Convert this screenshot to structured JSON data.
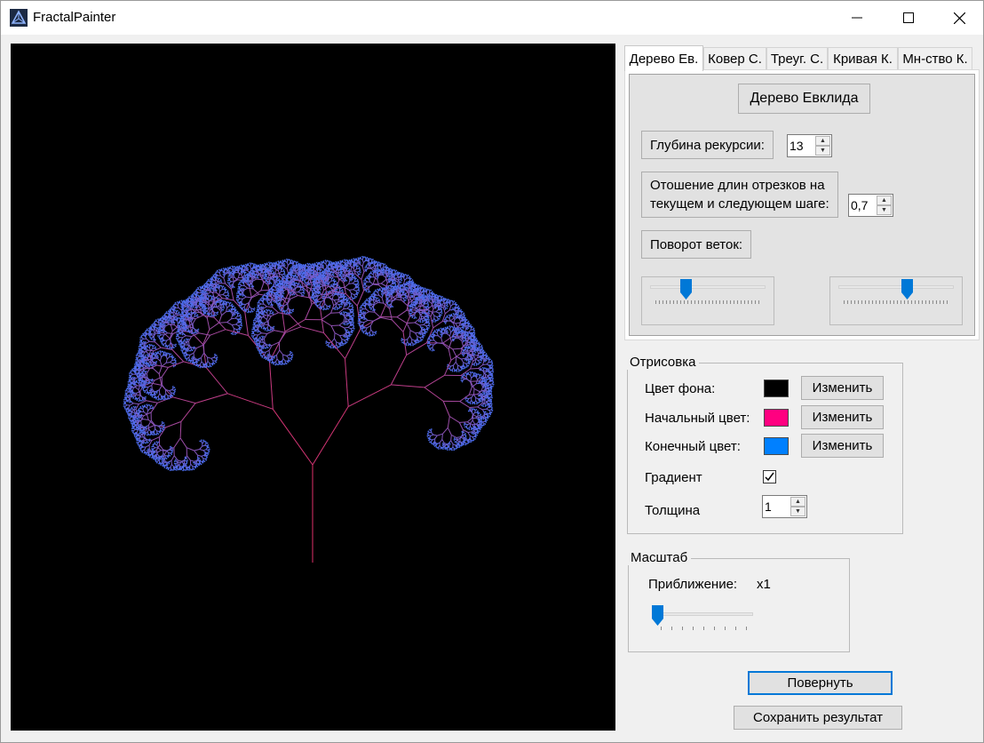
{
  "window": {
    "title": "FractalPainter",
    "icons": {
      "app": "fractal-app-icon",
      "minimize": "minimize-icon",
      "maximize": "maximize-icon",
      "close": "close-icon"
    }
  },
  "tabs": [
    {
      "label": "Дерево Ев.",
      "active": true
    },
    {
      "label": "Ковер С.",
      "active": false
    },
    {
      "label": "Треуг. С.",
      "active": false
    },
    {
      "label": "Кривая К.",
      "active": false
    },
    {
      "label": "Мн-ство К.",
      "active": false
    }
  ],
  "tree_panel": {
    "title_button": "Дерево Евклида",
    "depth_label": "Глубина рекурсии:",
    "depth_value": "13",
    "ratio_label_line1": "Отошение длин отрезков на",
    "ratio_label_line2": "текущем и следующем шаге:",
    "ratio_value": "0,7",
    "rotation_label": "Поворот веток:",
    "rotation_left_level": 0.29,
    "rotation_right_level": 0.61
  },
  "drawing": {
    "group_title": "Отрисовка",
    "bg_label": "Цвет фона:",
    "bg_color": "#000000",
    "start_label": "Начальный цвет:",
    "start_color": "#ff0080",
    "end_label": "Конечный цвет:",
    "end_color": "#0080ff",
    "change_label": "Изменить",
    "gradient_label": "Градиент",
    "gradient_checked": true,
    "thickness_label": "Толщина",
    "thickness_value": "1"
  },
  "scale": {
    "group_title": "Масштаб",
    "zoom_label": "Приближение:",
    "zoom_value": "x1",
    "zoom_level": 0
  },
  "actions": {
    "rotate": "Повернуть",
    "save": "Сохранить результат"
  },
  "canvas": {
    "background": "#000000",
    "start_color": "#e0306a",
    "end_color": "#4a6ef0"
  }
}
